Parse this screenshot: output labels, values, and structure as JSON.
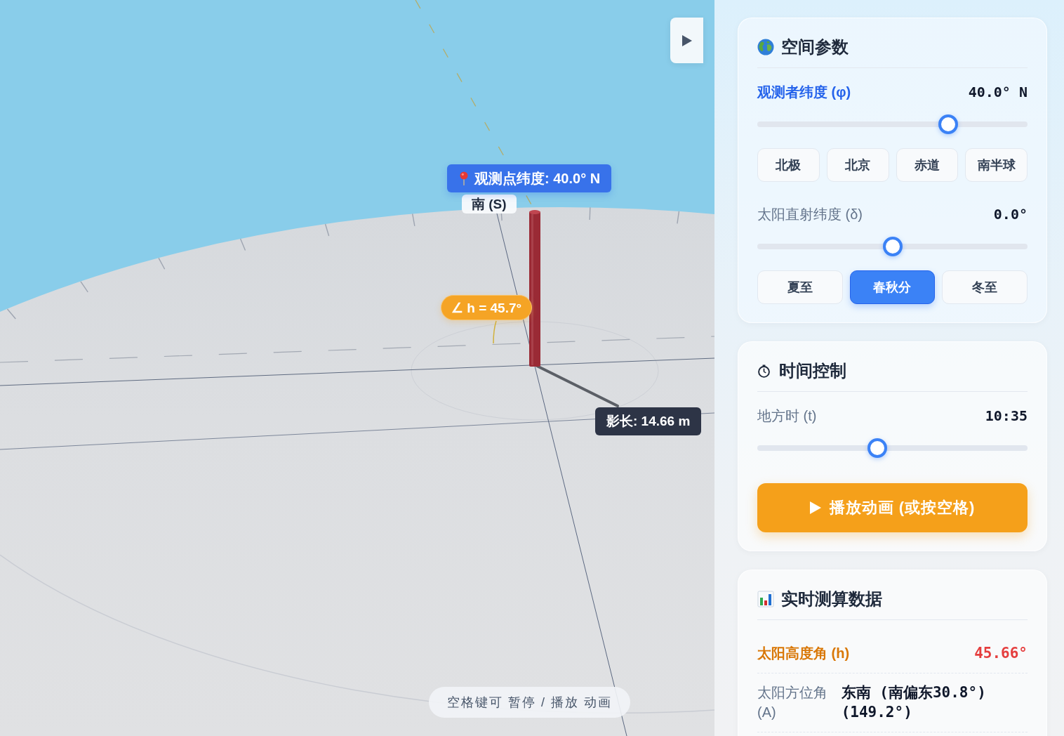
{
  "scene": {
    "south_label": "南 (S)",
    "latitude_tag": "观测点纬度: 40.0° N",
    "altitude_tag": "∠ h = 45.7°",
    "shadow_tag": "影长: 14.66 m",
    "hint": "空格键可 暂停 / 播放 动画"
  },
  "space_card": {
    "title": "空间参数",
    "controls": [
      {
        "label": "观测者纬度 (φ)",
        "value": "40.0° N",
        "highlighted": true,
        "level": 0.722,
        "presets": [
          {
            "label": "北极",
            "selected": false
          },
          {
            "label": "北京",
            "selected": false
          },
          {
            "label": "赤道",
            "selected": false
          },
          {
            "label": "南半球",
            "selected": false
          }
        ]
      },
      {
        "label": "太阳直射纬度 (δ)",
        "value": "0.0°",
        "highlighted": false,
        "level": 0.5,
        "presets": [
          {
            "label": "夏至",
            "selected": false
          },
          {
            "label": "春秋分",
            "selected": true
          },
          {
            "label": "冬至",
            "selected": false
          }
        ]
      }
    ]
  },
  "time_card": {
    "title": "时间控制",
    "controls": [
      {
        "label": "地方时 (t)",
        "value": "10:35",
        "highlighted": false,
        "level": 0.441
      }
    ],
    "play_button": "播放动画 (或按空格)"
  },
  "data_card": {
    "title": "实时测算数据",
    "readings": [
      {
        "label": "太阳高度角 (h)",
        "value": "45.66°",
        "highlighted": true
      },
      {
        "label": "太阳方位角 (A)",
        "value": "东南 (南偏东30.8°) (149.2°)",
        "highlighted": false
      }
    ]
  }
}
